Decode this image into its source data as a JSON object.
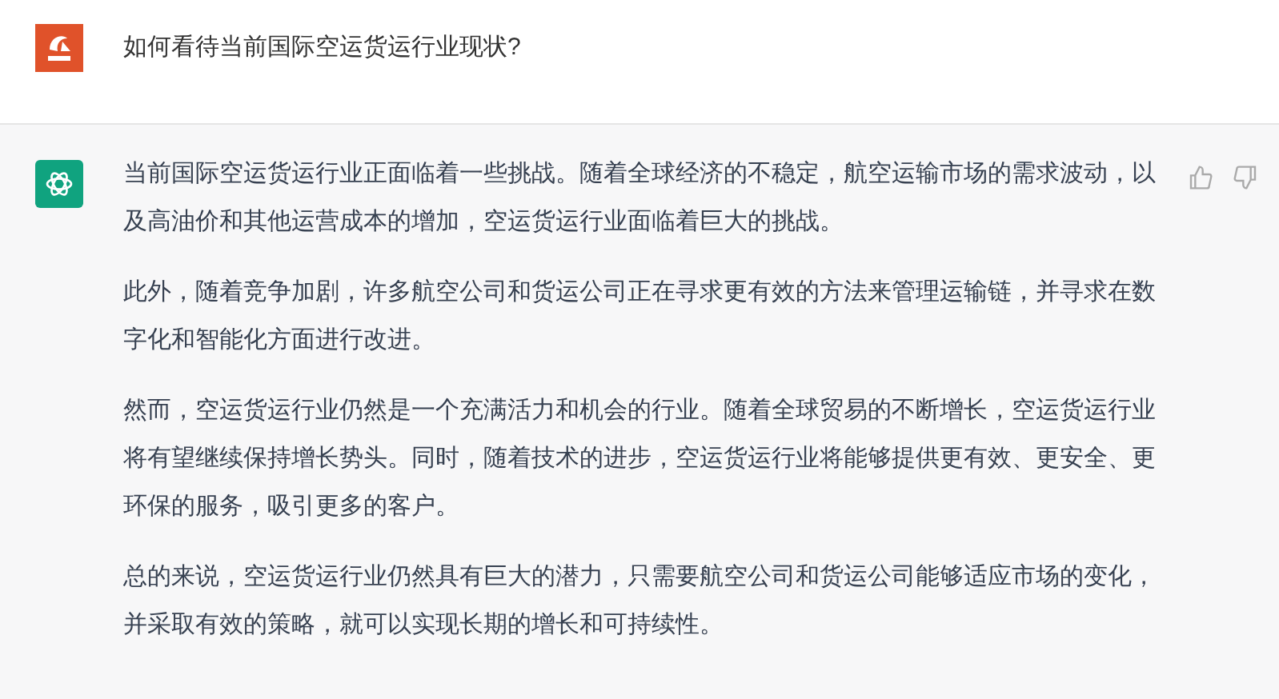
{
  "question": {
    "text": "如何看待当前国际空运货运行业现状?"
  },
  "answer": {
    "paragraphs": [
      "当前国际空运货运行业正面临着一些挑战。随着全球经济的不稳定，航空运输市场的需求波动，以及高油价和其他运营成本的增加，空运货运行业面临着巨大的挑战。",
      "此外，随着竞争加剧，许多航空公司和货运公司正在寻求更有效的方法来管理运输链，并寻求在数字化和智能化方面进行改进。",
      "然而，空运货运行业仍然是一个充满活力和机会的行业。随着全球贸易的不断增长，空运货运行业将有望继续保持增长势头。同时，随着技术的进步，空运货运行业将能够提供更有效、更安全、更环保的服务，吸引更多的客户。",
      "总的来说，空运货运行业仍然具有巨大的潜力，只需要航空公司和货运公司能够适应市场的变化，并采取有效的策略，就可以实现长期的增长和可持续性。"
    ]
  }
}
